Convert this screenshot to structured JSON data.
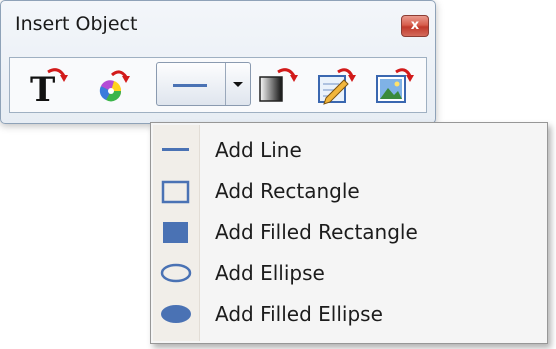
{
  "window": {
    "title": "Insert Object",
    "close_label": "x"
  },
  "toolbar": {
    "buttons": [
      {
        "name": "text-object",
        "icon": "text-T-with-arrow-icon"
      },
      {
        "name": "color-object",
        "icon": "color-wheel-icon"
      },
      {
        "name": "shape-dropdown",
        "icon": "line-icon",
        "dropdown_arrow": "chevron-down-icon"
      },
      {
        "name": "gradient-object",
        "icon": "gradient-square-icon"
      },
      {
        "name": "edit-object",
        "icon": "edit-pencil-icon"
      },
      {
        "name": "image-object",
        "icon": "picture-icon"
      }
    ]
  },
  "menu": {
    "items": [
      {
        "label": "Add Line",
        "icon": "line-icon"
      },
      {
        "label": "Add Rectangle",
        "icon": "rectangle-icon"
      },
      {
        "label": "Add Filled Rectangle",
        "icon": "filled-rectangle-icon"
      },
      {
        "label": "Add Ellipse",
        "icon": "ellipse-icon"
      },
      {
        "label": "Add Filled Ellipse",
        "icon": "filled-ellipse-icon"
      }
    ]
  },
  "colors": {
    "shape_blue": "#4a72b4",
    "arrow_red": "#d21a1a"
  }
}
